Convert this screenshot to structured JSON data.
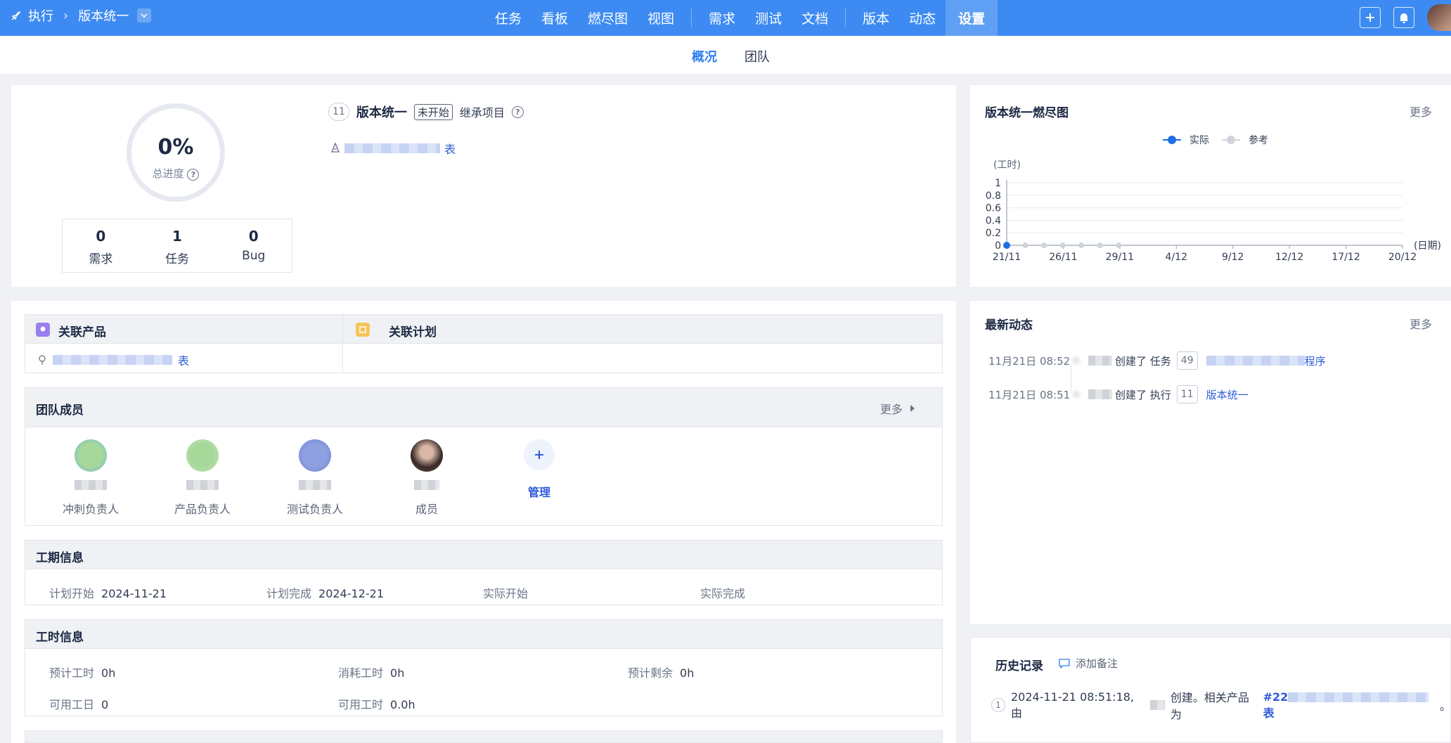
{
  "topbar": {
    "crumb_root": "执行",
    "crumb_current": "版本统一",
    "nav": [
      "任务",
      "看板",
      "燃尽图",
      "视图",
      "需求",
      "测试",
      "文档",
      "版本",
      "动态",
      "设置"
    ],
    "active_nav": "设置"
  },
  "subnav": {
    "tabs": [
      "概况",
      "团队"
    ],
    "active": "概况"
  },
  "overview": {
    "progress": "0%",
    "progress_label": "总进度",
    "stats": [
      {
        "num": "0",
        "name": "需求"
      },
      {
        "num": "1",
        "name": "任务"
      },
      {
        "num": "0",
        "name": "Bug"
      }
    ],
    "exec_id": "11",
    "exec_name": "版本统一",
    "status": "未开始",
    "inherit": "继承项目",
    "project_link_tail": "表"
  },
  "burndown": {
    "title": "版本统一燃尽图",
    "more": "更多",
    "legend_actual": "实际",
    "legend_ref": "参考",
    "ylabel": "(工时)",
    "xlabel": "(日期)"
  },
  "chart_data": {
    "type": "line",
    "title": "版本统一燃尽图",
    "xlabel": "(日期)",
    "ylabel": "(工时)",
    "ylim": [
      0,
      1
    ],
    "yticks": [
      "0",
      "0.2",
      "0.4",
      "0.6",
      "0.8",
      "1"
    ],
    "x_tick_labels": [
      "21/11",
      "26/11",
      "29/11",
      "4/12",
      "9/12",
      "12/12",
      "17/12",
      "20/12"
    ],
    "series": [
      {
        "name": "实际",
        "x": [
          "21/11"
        ],
        "values": [
          0
        ],
        "color": "#1f6ee8"
      },
      {
        "name": "参考",
        "x": [
          "21/11",
          "23/11",
          "25/11",
          "27/11",
          "29/11",
          "1/12",
          "3/12"
        ],
        "values": [
          0,
          0,
          0,
          0,
          0,
          0,
          0
        ],
        "color": "#cfd3da"
      }
    ],
    "legend": "top-center",
    "grid": true
  },
  "related": {
    "product_header": "关联产品",
    "plan_header": "关联计划",
    "product_link_tail": "表"
  },
  "team": {
    "title": "团队成员",
    "more": "更多",
    "roles": [
      "冲刺负责人",
      "产品负责人",
      "测试负责人",
      "成员"
    ],
    "manage": "管理"
  },
  "schedule": {
    "title": "工期信息",
    "items": [
      {
        "k": "计划开始",
        "v": "2024-11-21"
      },
      {
        "k": "计划完成",
        "v": "2024-12-21"
      },
      {
        "k": "实际开始",
        "v": ""
      },
      {
        "k": "实际完成",
        "v": ""
      }
    ]
  },
  "hours": {
    "title": "工时信息",
    "items": [
      {
        "k": "预计工时",
        "v": "0h"
      },
      {
        "k": "消耗工时",
        "v": "0h"
      },
      {
        "k": "预计剩余",
        "v": "0h"
      },
      {
        "k": "可用工日",
        "v": "0"
      },
      {
        "k": "可用工时",
        "v": "0.0h"
      }
    ]
  },
  "dynamics": {
    "title": "最新动态",
    "more": "更多",
    "items": [
      {
        "time": "11月21日 08:52",
        "action": "创建了 任务",
        "id": "49",
        "link_tail": "程序"
      },
      {
        "time": "11月21日 08:51",
        "action": "创建了 执行",
        "id": "11",
        "link": "版本统一"
      }
    ]
  },
  "history": {
    "title": "历史记录",
    "add_note": "添加备注",
    "index": "1",
    "text_a": "2024-11-21 08:51:18, 由",
    "text_b": "创建。相关产品为",
    "link_head": "#22",
    "link_tail": "表",
    "text_end": "。"
  }
}
